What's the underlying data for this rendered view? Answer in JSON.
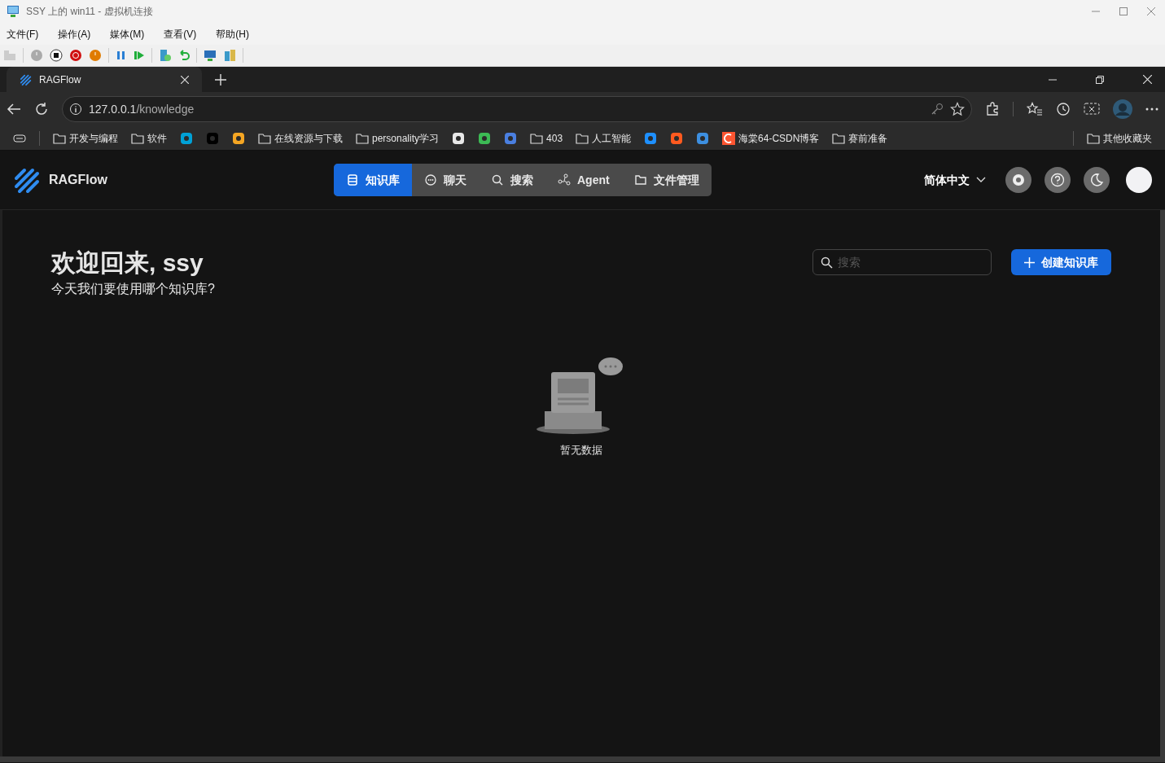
{
  "vm_window": {
    "title": "SSY 上的 win11 - 虚拟机连接",
    "menus": [
      "文件(F)",
      "操作(A)",
      "媒体(M)",
      "查看(V)",
      "帮助(H)"
    ]
  },
  "browser": {
    "tabs": [
      {
        "title": "RAGFlow",
        "selected": true
      }
    ],
    "address": {
      "host": "127.0.0.1",
      "path": "/knowledge"
    },
    "bookmarks": [
      {
        "kind": "folder",
        "label": "开发与编程"
      },
      {
        "kind": "folder",
        "label": "软件"
      },
      {
        "kind": "site"
      },
      {
        "kind": "site"
      },
      {
        "kind": "site"
      },
      {
        "kind": "folder",
        "label": "在线资源与下载"
      },
      {
        "kind": "folder",
        "label": "personality学习"
      },
      {
        "kind": "site"
      },
      {
        "kind": "site"
      },
      {
        "kind": "site"
      },
      {
        "kind": "folder",
        "label": "403"
      },
      {
        "kind": "folder",
        "label": "人工智能"
      },
      {
        "kind": "site"
      },
      {
        "kind": "site"
      },
      {
        "kind": "site"
      },
      {
        "kind": "site",
        "label": "海棠64-CSDN博客"
      },
      {
        "kind": "folder",
        "label": "赛前准备"
      }
    ],
    "other_bookmarks": "其他收藏夹"
  },
  "app": {
    "brand": "RAGFlow",
    "nav": [
      {
        "label": "知识库",
        "selected": true
      },
      {
        "label": "聊天",
        "selected": false
      },
      {
        "label": "搜索",
        "selected": false
      },
      {
        "label": "Agent",
        "selected": false
      },
      {
        "label": "文件管理",
        "selected": false
      }
    ],
    "language": "简体中文",
    "heading": "欢迎回来, ssy",
    "subheading": "今天我们要使用哪个知识库?",
    "search": {
      "placeholder": "搜索"
    },
    "create_button": "创建知识库",
    "empty_text": "暂无数据"
  }
}
